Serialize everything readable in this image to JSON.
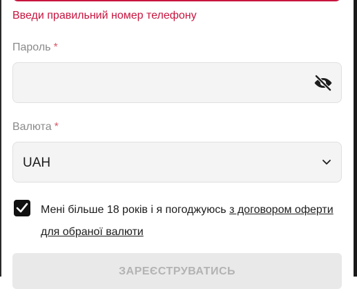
{
  "phone": {
    "error": "Введи правильний номер телефону"
  },
  "password": {
    "label": "Пароль",
    "required_mark": "*",
    "value": "",
    "visibility_icon": "eye-slash-icon"
  },
  "currency": {
    "label": "Валюта",
    "required_mark": "*",
    "selected": "UAH",
    "dropdown_icon": "chevron-down-icon"
  },
  "agreement": {
    "checked": true,
    "text": "Мені більше 18 років і я погоджуюсь ",
    "link_text": "з договором оферти для обраної валюти"
  },
  "submit": {
    "label": "ЗАРЕЄСТРУВАТИСЬ"
  },
  "colors": {
    "error": "#c8143e",
    "label": "#8a8a8a",
    "field_bg": "#f4f4f4",
    "checkbox": "#111111",
    "button_disabled_bg": "#e9e9e9",
    "button_disabled_text": "#b3b3b3"
  }
}
